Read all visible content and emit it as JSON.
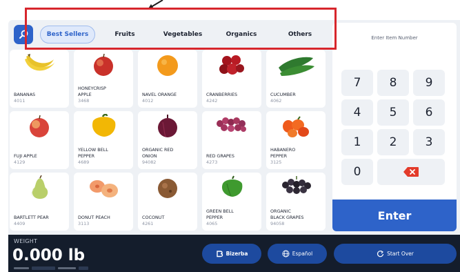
{
  "categories": {
    "tabs": [
      {
        "label": "Best Sellers",
        "active": true
      },
      {
        "label": "Fruits",
        "active": false
      },
      {
        "label": "Vegetables",
        "active": false
      },
      {
        "label": "Organics",
        "active": false
      },
      {
        "label": "Others",
        "active": false
      }
    ]
  },
  "products": [
    {
      "name_line1": "",
      "name_line2": "BANANAS",
      "code": "4011",
      "icon": "banana-icon"
    },
    {
      "name_line1": "HONEYCRISP",
      "name_line2": "APPLE",
      "code": "3468",
      "icon": "apple-icon"
    },
    {
      "name_line1": "",
      "name_line2": "NAVEL ORANGE",
      "code": "4012",
      "icon": "orange-icon"
    },
    {
      "name_line1": "",
      "name_line2": "CRANBERRIES",
      "code": "4242",
      "icon": "cranberries-icon"
    },
    {
      "name_line1": "",
      "name_line2": "CUCUMBER",
      "code": "4062",
      "icon": "cucumber-icon"
    },
    {
      "name_line1": "",
      "name_line2": "FUJI APPLE",
      "code": "4129",
      "icon": "fuji-apple-icon"
    },
    {
      "name_line1": "YELLOW BELL",
      "name_line2": "PEPPER",
      "code": "4689",
      "icon": "yellow-pepper-icon"
    },
    {
      "name_line1": "ORGANIC RED",
      "name_line2": "ONION",
      "code": "94082",
      "icon": "red-onion-icon"
    },
    {
      "name_line1": "",
      "name_line2": "RED GRAPES",
      "code": "4273",
      "icon": "red-grapes-icon"
    },
    {
      "name_line1": "HABANERO",
      "name_line2": "PEPPER",
      "code": "3125",
      "icon": "habanero-icon"
    },
    {
      "name_line1": "",
      "name_line2": "BARTLETT PEAR",
      "code": "4409",
      "icon": "pear-icon"
    },
    {
      "name_line1": "",
      "name_line2": "DONUT PEACH",
      "code": "3113",
      "icon": "peach-icon"
    },
    {
      "name_line1": "",
      "name_line2": "COCONUT",
      "code": "4261",
      "icon": "coconut-icon"
    },
    {
      "name_line1": "GREEN BELL",
      "name_line2": "PEPPER",
      "code": "4065",
      "icon": "green-pepper-icon"
    },
    {
      "name_line1": "ORGANIC",
      "name_line2": "BLACK GRAPES",
      "code": "94058",
      "icon": "black-grapes-icon"
    }
  ],
  "keypad": {
    "title": "Enter Item Number",
    "keys": [
      "7",
      "8",
      "9",
      "4",
      "5",
      "6",
      "1",
      "2",
      "3",
      "0"
    ],
    "enter_label": "Enter"
  },
  "bottom_bar": {
    "weight_label": "WEIGHT",
    "weight_value": "0.000 lb",
    "btn_retailer": "Bizerba",
    "btn_language": "Español",
    "btn_start_over": "Start Over"
  },
  "colors": {
    "accent": "#2e63c9",
    "backspace": "#e33b2a",
    "annotation": "#d7262c",
    "bottom_bar": "#141d2c"
  }
}
